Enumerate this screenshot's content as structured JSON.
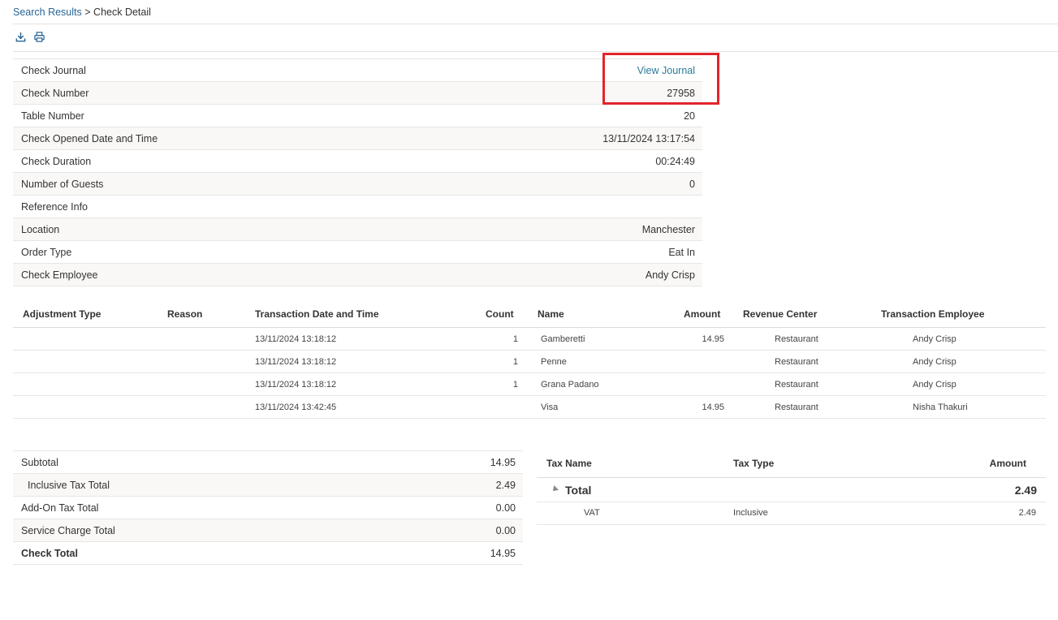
{
  "breadcrumb": {
    "parent": "Search Results",
    "separator": ">",
    "current": "Check Detail"
  },
  "toolbar": {
    "download_icon": "download-icon",
    "print_icon": "print-icon"
  },
  "check_details": [
    {
      "label": "Check Journal",
      "value": "View Journal",
      "is_link": true
    },
    {
      "label": "Check Number",
      "value": "27958"
    },
    {
      "label": "Table Number",
      "value": "20"
    },
    {
      "label": "Check Opened Date and Time",
      "value": "13/11/2024 13:17:54"
    },
    {
      "label": "Check Duration",
      "value": "00:24:49"
    },
    {
      "label": "Number of Guests",
      "value": "0"
    },
    {
      "label": "Reference Info",
      "value": ""
    },
    {
      "label": "Location",
      "value": "Manchester"
    },
    {
      "label": "Order Type",
      "value": "Eat In"
    },
    {
      "label": "Check Employee",
      "value": "Andy Crisp"
    }
  ],
  "transactions": {
    "columns": [
      "Adjustment Type",
      "Reason",
      "Transaction Date and Time",
      "Count",
      "Name",
      "Amount",
      "Revenue Center",
      "Transaction Employee"
    ],
    "rows": [
      {
        "adjustment_type": "",
        "reason": "",
        "datetime": "13/11/2024 13:18:12",
        "count": "1",
        "name": "Gamberetti",
        "amount": "14.95",
        "revenue_center": "Restaurant",
        "employee": "Andy Crisp"
      },
      {
        "adjustment_type": "",
        "reason": "",
        "datetime": "13/11/2024 13:18:12",
        "count": "1",
        "name": "Penne",
        "amount": "",
        "revenue_center": "Restaurant",
        "employee": "Andy Crisp"
      },
      {
        "adjustment_type": "",
        "reason": "",
        "datetime": "13/11/2024 13:18:12",
        "count": "1",
        "name": "Grana Padano",
        "amount": "",
        "revenue_center": "Restaurant",
        "employee": "Andy Crisp"
      },
      {
        "adjustment_type": "",
        "reason": "",
        "datetime": "13/11/2024 13:42:45",
        "count": "",
        "name": "Visa",
        "amount": "14.95",
        "revenue_center": "Restaurant",
        "employee": "Nisha Thakuri"
      }
    ]
  },
  "totals": [
    {
      "label": "Subtotal",
      "value": "14.95"
    },
    {
      "label": "Inclusive Tax Total",
      "value": "2.49"
    },
    {
      "label": "Add-On Tax Total",
      "value": "0.00"
    },
    {
      "label": "Service Charge Total",
      "value": "0.00"
    },
    {
      "label": "Check Total",
      "value": "14.95"
    }
  ],
  "tax": {
    "columns": [
      "Tax Name",
      "Tax Type",
      "Amount"
    ],
    "group": {
      "label": "Total",
      "amount": "2.49"
    },
    "rows": [
      {
        "name": "VAT",
        "type": "Inclusive",
        "amount": "2.49"
      }
    ]
  },
  "colors": {
    "link": "#2a7a9a",
    "highlight": "#e3242b",
    "row_alt": "#f9f8f6"
  }
}
